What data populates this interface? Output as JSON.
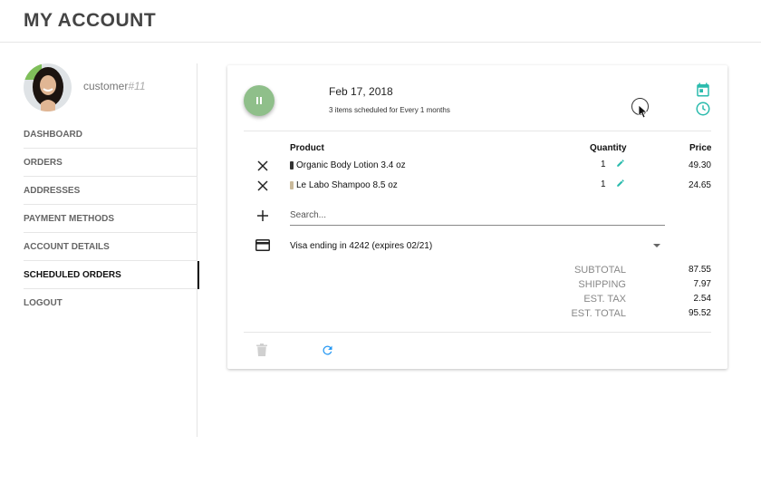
{
  "header": {
    "title": "MY ACCOUNT"
  },
  "user": {
    "name": "customer",
    "number": "#11"
  },
  "nav": {
    "items": [
      {
        "label": "DASHBOARD"
      },
      {
        "label": "ORDERS"
      },
      {
        "label": "ADDRESSES"
      },
      {
        "label": "PAYMENT METHODS"
      },
      {
        "label": "ACCOUNT DETAILS"
      },
      {
        "label": "SCHEDULED ORDERS",
        "active": true
      },
      {
        "label": "LOGOUT"
      }
    ]
  },
  "schedule": {
    "date": "Feb 17, 2018",
    "summary": "3 items scheduled for Every 1 months",
    "status_icon": "pause-icon",
    "colors": {
      "accent": "#2bbbad",
      "pause": "#8fbf8a",
      "refresh": "#2196f3"
    }
  },
  "table": {
    "headers": {
      "product": "Product",
      "quantity": "Quantity",
      "price": "Price"
    },
    "rows": [
      {
        "product": "Organic Body Lotion 3.4 oz",
        "quantity": "1",
        "price": "49.30"
      },
      {
        "product": "Le Labo Shampoo 8.5 oz",
        "quantity": "1",
        "price": "24.65"
      }
    ]
  },
  "search": {
    "placeholder": "Search..."
  },
  "payment": {
    "label": "Visa ending in 4242 (expires 02/21)"
  },
  "totals": [
    {
      "label": "SUBTOTAL",
      "value": "87.55"
    },
    {
      "label": "SHIPPING",
      "value": "7.97"
    },
    {
      "label": "EST. TAX",
      "value": "2.54"
    },
    {
      "label": "EST. TOTAL",
      "value": "95.52"
    }
  ]
}
